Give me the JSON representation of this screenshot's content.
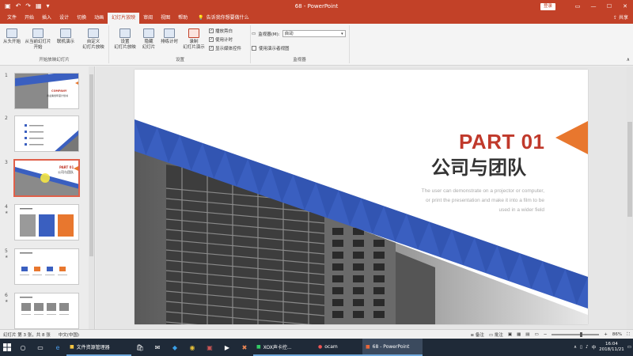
{
  "titlebar": {
    "title": "68 - PowerPoint",
    "login_label": "登录",
    "qat_icons": [
      "save-icon",
      "undo-icon",
      "redo-icon",
      "present-icon",
      "customize-icon"
    ]
  },
  "tabs": {
    "items": [
      "文件",
      "开始",
      "插入",
      "设计",
      "切换",
      "动画",
      "幻灯片放映",
      "审阅",
      "视图",
      "帮助"
    ],
    "active_index": 6,
    "tell_me": "告诉我你想要做什么",
    "share_label": "共享"
  },
  "ribbon": {
    "start_group_label": "开始放映幻灯片",
    "setup_group_label": "设置",
    "monitor_group_label": "监视器",
    "btn_from_beginning": "从头开始",
    "btn_from_current_1": "从当前幻灯片",
    "btn_from_current_2": "开始",
    "btn_online_1": "联机演示",
    "btn_online_2": "",
    "btn_custom_1": "自定义",
    "btn_custom_2": "幻灯片放映",
    "btn_setup_1": "设置",
    "btn_setup_2": "幻灯片放映",
    "btn_hide_1": "隐藏",
    "btn_hide_2": "幻灯片",
    "btn_rehearse": "排练计时",
    "btn_record_1": "录制",
    "btn_record_2": "幻灯片演示",
    "chk_narrations": "播放旁白",
    "chk_timings": "使用计时",
    "chk_media": "显示媒体控件",
    "monitor_label": "监视器(M):",
    "monitor_value": "自动",
    "presenter_view": "使用演示者视图"
  },
  "thumbnails": {
    "numbers": [
      "1",
      "2",
      "3",
      "4",
      "5",
      "6"
    ],
    "selected_index": 2,
    "t1_title": "COMPANY",
    "t1_sub": "商业策划年度计划书",
    "t3_part": "PART 01",
    "t3_cn": "公司与团队"
  },
  "slide": {
    "part_title": "PART 01",
    "cn_title": "公司与团队",
    "desc_lines": [
      "The user can demonstrate on a projector or computer,",
      "or print the presentation and make it into a film to be",
      "used in a wider field"
    ],
    "accent_color": "#3a5fc0",
    "orange_color": "#e8772e",
    "red_color": "#c0392b"
  },
  "statusbar": {
    "slide_info": "幻灯片 第 3 张，共 8 张",
    "language": "中文(中国)",
    "notes_label": "备注",
    "comments_label": "批注",
    "zoom": "86%"
  },
  "taskbar": {
    "apps": [
      "文件资源管理器",
      "XOX声卡控...",
      "ocam",
      "68 - PowerPoint"
    ],
    "tray_lang": "中",
    "time": "16:04",
    "date": "2018/11/21"
  }
}
